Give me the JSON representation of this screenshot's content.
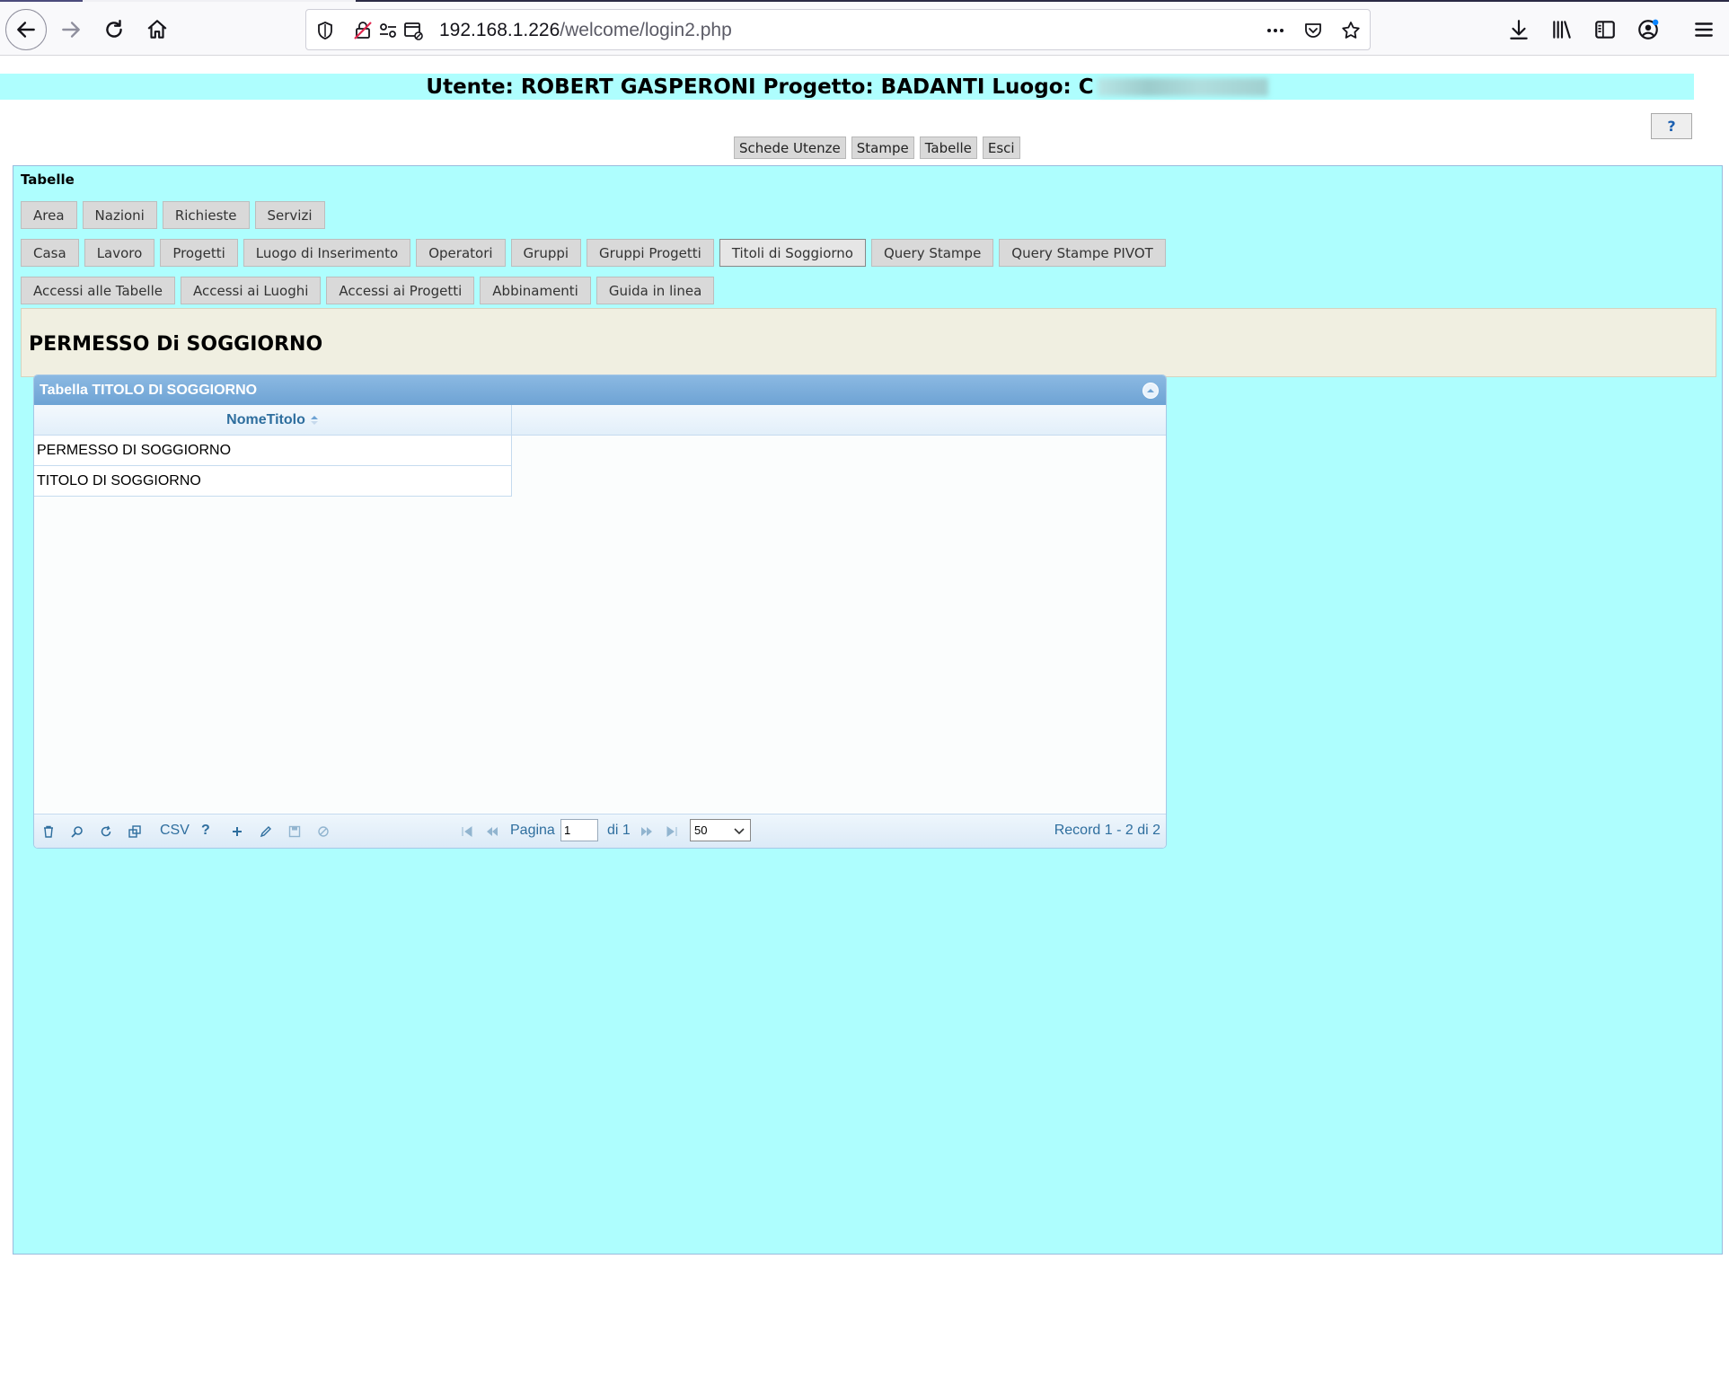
{
  "browser": {
    "url_host": "192.168.1.226",
    "url_path": "/welcome/login2.php"
  },
  "header": {
    "title": "Utente: ROBERT GASPERONI Progetto: BADANTI Luogo: C",
    "luogo_redacted": "CARITAS ROMANO"
  },
  "help_button": "?",
  "top_menu": [
    "Schede Utenze",
    "Stampe",
    "Tabelle",
    "Esci"
  ],
  "panel": {
    "label": "Tabelle",
    "tab_rows": [
      [
        "Area",
        "Nazioni",
        "Richieste",
        "Servizi"
      ],
      [
        "Casa",
        "Lavoro",
        "Progetti",
        "Luogo di Inserimento",
        "Operatori",
        "Gruppi",
        "Gruppi Progetti",
        "Titoli di Soggiorno",
        "Query Stampe",
        "Query Stampe PIVOT"
      ],
      [
        "Accessi alle Tabelle",
        "Accessi ai Luoghi",
        "Accessi ai Progetti",
        "Abbinamenti",
        "Guida in linea"
      ]
    ],
    "active_tab": "Titoli di Soggiorno",
    "section_title": "PERMESSO Di SOGGIORNO"
  },
  "grid": {
    "caption": "Tabella TITOLO DI SOGGIORNO",
    "column": "NomeTitolo",
    "rows": [
      "PERMESSO DI SOGGIORNO",
      "TITOLO DI SOGGIORNO"
    ],
    "pager": {
      "csv_label": "CSV",
      "help_label": "?",
      "page_label": "Pagina",
      "page_value": "1",
      "of_label": "di 1",
      "rows_per_page": "50",
      "record_info": "Record 1 - 2 di 2"
    }
  },
  "colors": {
    "page_band": "#aefefe",
    "section_bg": "#f0efe1",
    "grid_header": "#6ea3d4",
    "grid_text": "#2e6e9e"
  }
}
